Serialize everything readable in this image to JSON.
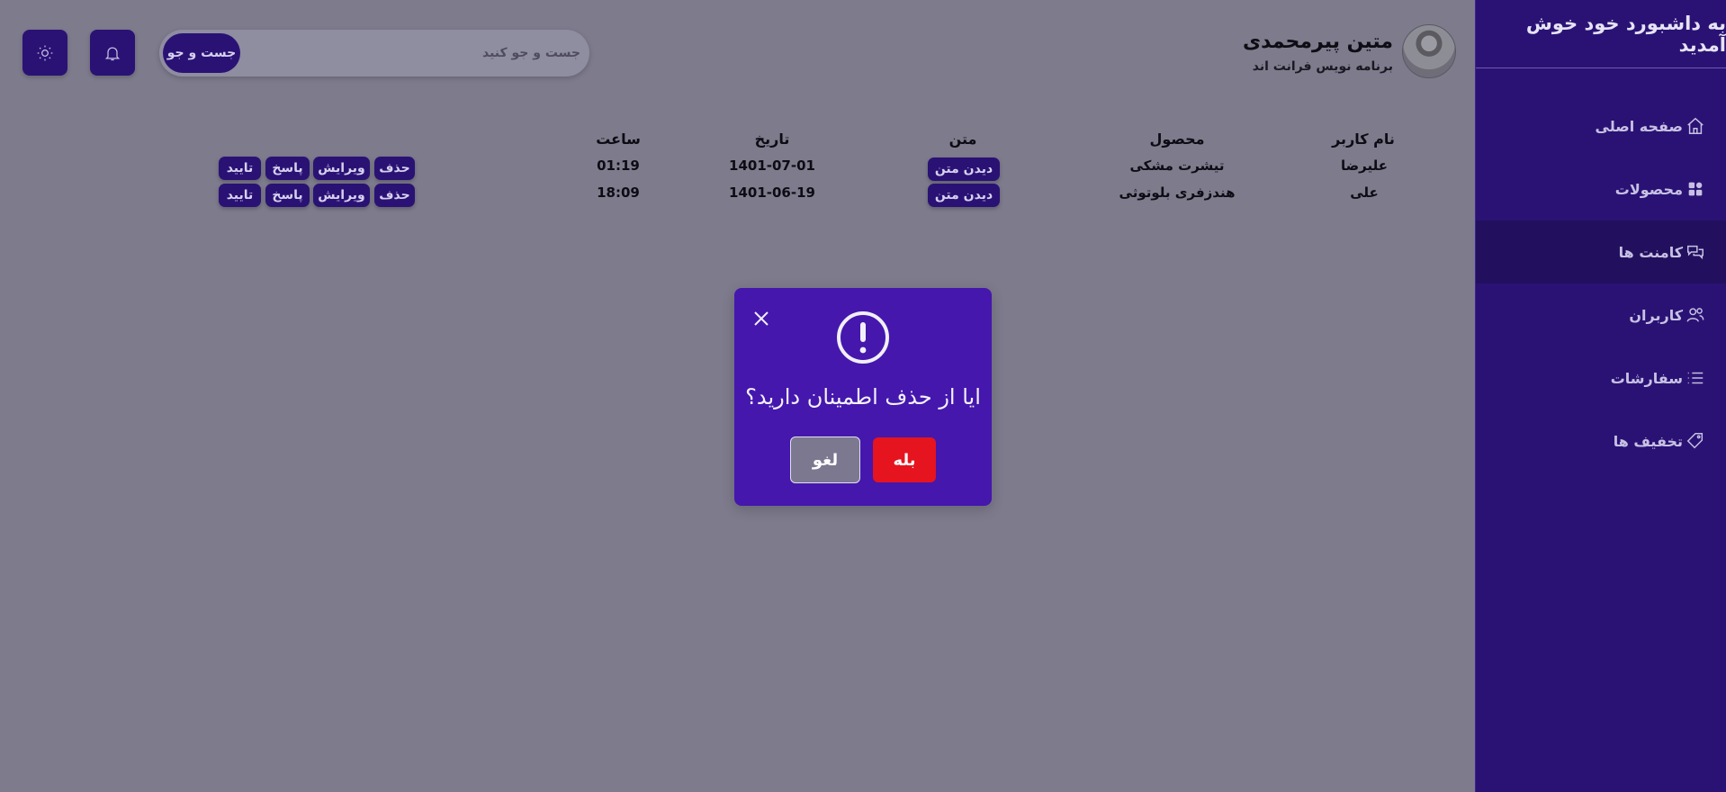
{
  "sidebar": {
    "title": "به داشبورد خود خوش آمدید",
    "items": [
      {
        "label": "صفحه اصلی",
        "icon": "home-icon"
      },
      {
        "label": "محصولات",
        "icon": "grid-icon"
      },
      {
        "label": "کامنت ها",
        "icon": "chat-icon"
      },
      {
        "label": "کاربران",
        "icon": "users-icon"
      },
      {
        "label": "سفارشات",
        "icon": "list-icon"
      },
      {
        "label": "تخفیف ها",
        "icon": "tag-icon"
      }
    ],
    "active_index": 2
  },
  "header": {
    "user_name": "متین پیرمحمدی",
    "user_role": "برنامه نویس فرانت اند",
    "search_placeholder": "جست و جو کنید",
    "search_button": "جست و جو",
    "icons": [
      "bell-icon",
      "sun-icon"
    ]
  },
  "comments_table": {
    "headers": [
      "نام کاربر",
      "محصول",
      "متن",
      "تاریخ",
      "ساعت"
    ],
    "rows": [
      {
        "user": "علیرضا",
        "product": "تیشرت مشکی",
        "text_button": "دیدن متن",
        "date": "1401-07-01",
        "time": "01:19",
        "actions": [
          "حذف",
          "ویرایش",
          "پاسخ",
          "تایید"
        ]
      },
      {
        "user": "علی",
        "product": "هندزفری بلوتوثی",
        "text_button": "دیدن متن",
        "date": "1401-06-19",
        "time": "18:09",
        "actions": [
          "حذف",
          "ویرایش",
          "پاسخ",
          "تایید"
        ]
      }
    ]
  },
  "modal": {
    "question": "ایا از حذف اطمینان دارید؟",
    "yes_label": "بله",
    "cancel_label": "لغو",
    "icon": "alert-circle-icon"
  },
  "colors": {
    "overlay_background": "#7d7b8c",
    "sidebar": "#2a1275",
    "modal": "#4517ad",
    "danger": "#e5141f"
  }
}
